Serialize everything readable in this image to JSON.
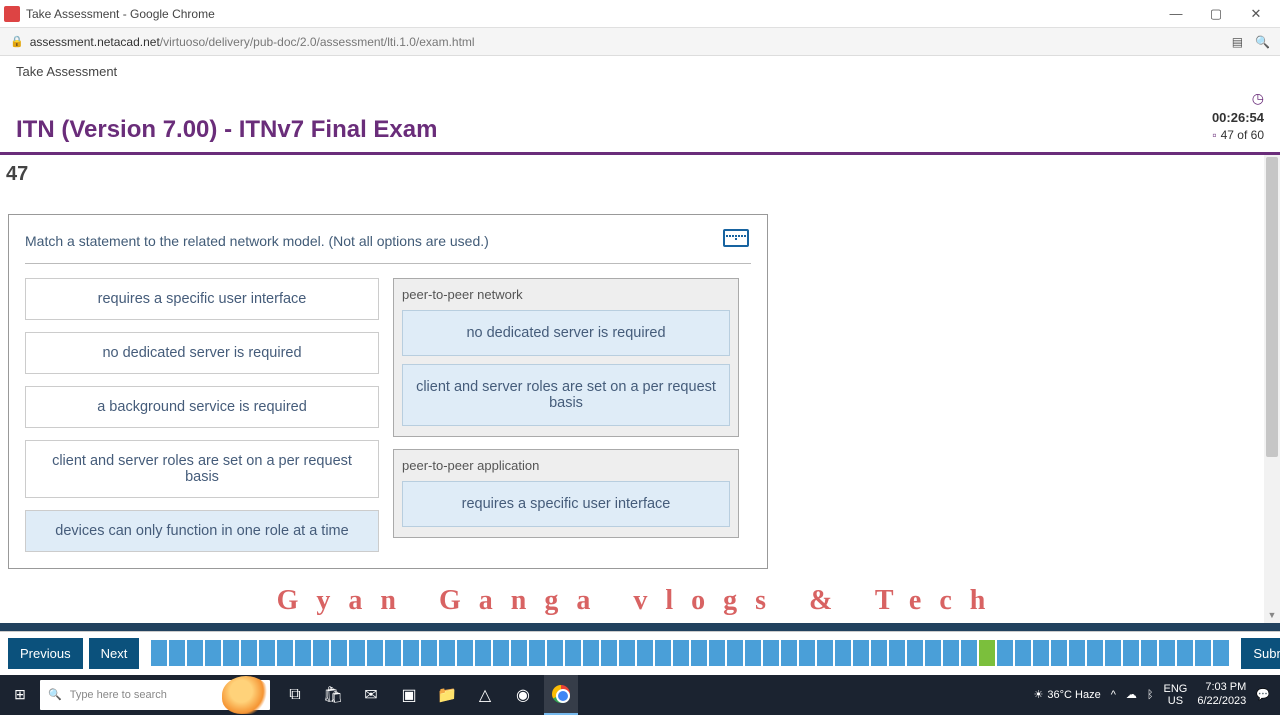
{
  "window": {
    "title": "Take Assessment - Google Chrome",
    "url_domain": "assessment.netacad.net",
    "url_path": "/virtuoso/delivery/pub-doc/2.0/assessment/lti.1.0/exam.html"
  },
  "page": {
    "breadcrumb": "Take Assessment",
    "title": "ITN (Version 7.00) - ITNv7 Final Exam",
    "timer": "00:26:54",
    "progress": "47 of 60",
    "question_number": "47"
  },
  "question": {
    "prompt": "Match a statement to the related network model. (Not all options are used.)",
    "options": {
      "o1": "requires a specific user interface",
      "o2": "no dedicated server is required",
      "o3": "a background service is required",
      "o4": "client and server roles are set on a per request basis",
      "o5": "devices can only function in one role at a time"
    },
    "targets": {
      "t1": {
        "label": "peer-to-peer network",
        "placed": [
          "no dedicated server is required",
          "client and server roles are set on a per request basis"
        ]
      },
      "t2": {
        "label": "peer-to-peer application",
        "placed": [
          "requires a specific user interface"
        ]
      }
    }
  },
  "watermark": "Gyan Ganga vlogs & Tech",
  "nav": {
    "prev": "Previous",
    "next": "Next",
    "submit": "Submit",
    "total": 60,
    "current": 47
  },
  "taskbar": {
    "search_placeholder": "Type here to search",
    "weather": "36°C  Haze",
    "lang": "ENG\nUS",
    "time": "7:03 PM",
    "date": "6/22/2023"
  }
}
